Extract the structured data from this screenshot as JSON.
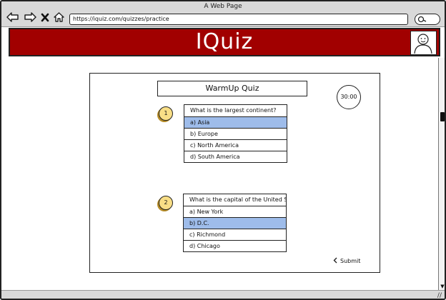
{
  "window": {
    "title": "A Web Page"
  },
  "browser": {
    "url": "https://iquiz.com/quizzes/practice",
    "nav_icons": [
      "back-arrow-icon",
      "forward-arrow-icon",
      "close-icon",
      "home-icon"
    ],
    "search_icon": "search-icon"
  },
  "header": {
    "brand": "IQuiz",
    "brand_color": "#a10000",
    "avatar_icon": "user-avatar-icon"
  },
  "quiz": {
    "title": "WarmUp Quiz",
    "timer": "30:00",
    "selected_color": "#9ebcea",
    "questions": [
      {
        "number": "1",
        "text": "What is the largest continent?",
        "options": [
          "a) Asia",
          "b) Europe",
          "c) North America",
          "d) South America"
        ],
        "selected_index": 0
      },
      {
        "number": "2",
        "text": "What is the capital of the United St",
        "options": [
          "a) New York",
          "b) D.C.",
          "c) Richmond",
          "d) Chicago"
        ],
        "selected_index": 1
      }
    ],
    "submit_label": "Submit",
    "submit_icon": "chevron-left-icon"
  }
}
